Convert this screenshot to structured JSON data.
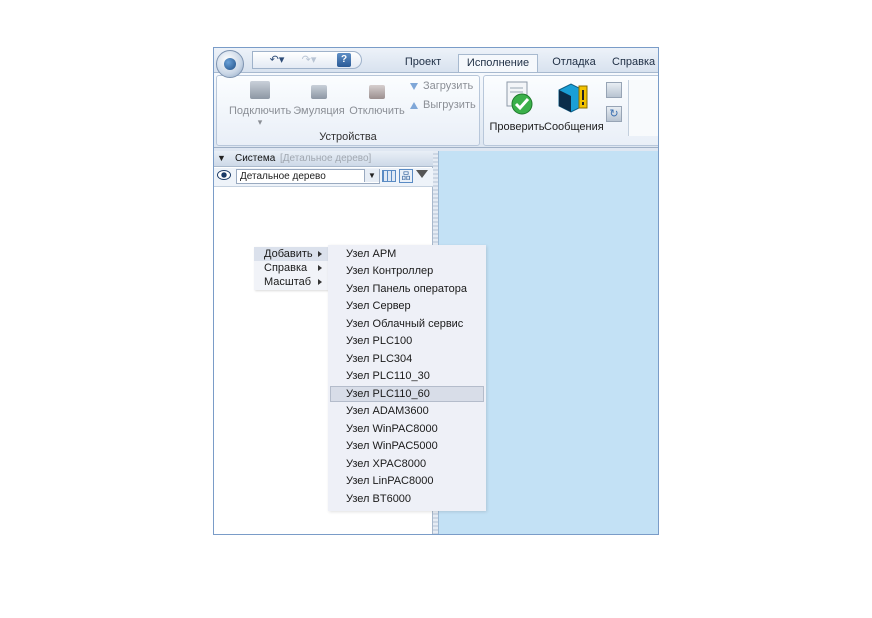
{
  "ribbon": {
    "tabs": [
      "Проект",
      "Исполнение",
      "Отладка",
      "Справка"
    ],
    "active_tab": "Исполнение",
    "devices_group": {
      "label": "Устройства",
      "connect_label": "Подключить",
      "emulation_label": "Эмуляция",
      "disconnect_label": "Отключить",
      "load_label": "Загрузить",
      "unload_label": "Выгрузить"
    },
    "check_label": "Проверить",
    "messages_label": "Сообщения"
  },
  "panel": {
    "header_title": "Система",
    "header_hint": "[Детальное дерево]",
    "tree_view": "Детальное дерево"
  },
  "context_menu": {
    "items": [
      "Добавить",
      "Справка",
      "Масштаб"
    ],
    "highlighted": "Добавить"
  },
  "submenu": {
    "items": [
      "Узел АРМ",
      "Узел Контроллер",
      "Узел Панель оператора",
      "Узел Сервер",
      "Узел Облачный сервис",
      "Узел PLC100",
      "Узел PLC304",
      "Узел PLC110_30",
      "Узел PLC110_60",
      "Узел ADAM3600",
      "Узел WinPAC8000",
      "Узел WinPAC5000",
      "Узел XPAC8000",
      "Узел LinPAC8000",
      "Узел BT6000"
    ],
    "highlighted": "Узел PLC110_60"
  },
  "colors": {
    "workspace": "#c3e1f5",
    "frame_border": "#7a9cc8",
    "check_icon": "#3bb04a",
    "messages_icon": "#1a9fd6",
    "warning_badge": "#f2c200"
  },
  "icons": [
    "app-menu-icon",
    "undo-icon",
    "redo-icon",
    "help-icon",
    "connect-icon",
    "emulation-icon",
    "disconnect-icon",
    "check-icon",
    "messages-icon",
    "copy-icon",
    "refresh-icon",
    "eye-icon",
    "grid-icon",
    "tree-icon",
    "filter-icon"
  ]
}
